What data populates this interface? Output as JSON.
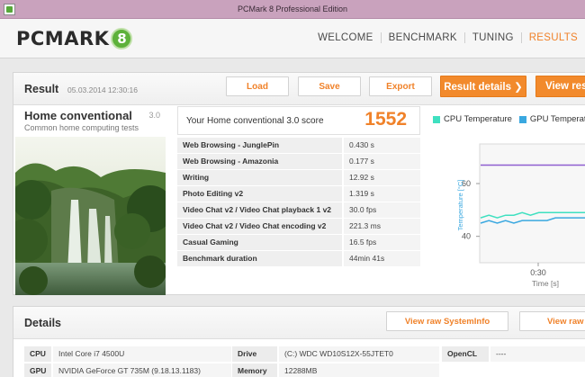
{
  "window": {
    "title": "PCMark 8 Professional Edition"
  },
  "logo": {
    "word": "PCMARK",
    "number": "8"
  },
  "nav": [
    {
      "label": "WELCOME",
      "active": false
    },
    {
      "label": "BENCHMARK",
      "active": false
    },
    {
      "label": "TUNING",
      "active": false
    },
    {
      "label": "RESULTS",
      "active": true
    }
  ],
  "result": {
    "title": "Result",
    "date": "05.03.2014 12:30:16",
    "buttons": {
      "load": "Load",
      "save": "Save",
      "export": "Export",
      "details": "Result details ❯",
      "view": "View resu"
    }
  },
  "test": {
    "name": "Home conventional",
    "version": "3.0",
    "description": "Common home computing tests"
  },
  "score": {
    "label": "Your Home conventional 3.0 score",
    "value": "1552",
    "rows": [
      {
        "name": "Web Browsing - JunglePin",
        "value": "0.430 s"
      },
      {
        "name": "Web Browsing - Amazonia",
        "value": "0.177 s"
      },
      {
        "name": "Writing",
        "value": "12.92 s"
      },
      {
        "name": "Photo Editing v2",
        "value": "1.319 s"
      },
      {
        "name": "Video Chat v2 / Video Chat playback 1 v2",
        "value": "30.0 fps"
      },
      {
        "name": "Video Chat v2 / Video Chat encoding v2",
        "value": "221.3 ms"
      },
      {
        "name": "Casual Gaming",
        "value": "16.5 fps"
      },
      {
        "name": "Benchmark duration",
        "value": "44min 41s"
      }
    ]
  },
  "chart": {
    "legend_cpu": "CPU Temperature",
    "legend_gpu": "GPU Temperatur",
    "y_label": "Temperature [°C]",
    "x_label": "Time [s]",
    "y_tick_60": "60",
    "y_tick_40": "40",
    "x_tick": "0:30",
    "colors": {
      "cpu": "#3fe0c0",
      "gpu": "#3aa8e0",
      "purple": "#8f5fd0"
    }
  },
  "chart_data": {
    "type": "line",
    "xlabel": "Time [s]",
    "ylabel": "Temperature [°C]",
    "ylim": [
      30,
      75
    ],
    "yticks": [
      40,
      60
    ],
    "xticks": [
      "0:30"
    ],
    "series": [
      {
        "name": "CPU Temperature",
        "color": "#3fe0c0",
        "values": [
          47,
          48,
          47,
          48,
          48,
          49,
          48,
          49,
          49,
          49,
          49,
          49,
          49,
          49
        ]
      },
      {
        "name": "GPU Temperatur",
        "color": "#3aa8e0",
        "values": [
          45,
          46,
          45,
          46,
          45,
          46,
          46,
          46,
          46,
          47,
          47,
          47,
          47,
          47
        ]
      },
      {
        "color": "#8f5fd0",
        "values": [
          67,
          67,
          67,
          67,
          67,
          67,
          67,
          67,
          67,
          67,
          67,
          67,
          67,
          67
        ]
      }
    ]
  },
  "details": {
    "title": "Details",
    "buttons": {
      "sysinfo": "View raw SystemInfo",
      "view": "View raw"
    },
    "specs": [
      {
        "key": "CPU",
        "value": "Intel Core i7 4500U"
      },
      {
        "key": "GPU",
        "value": "NVIDIA GeForce GT 735M (9.18.13.1183)"
      },
      {
        "key": "Drive",
        "value": "(C:) WDC WD10S12X-55JTET0"
      },
      {
        "key": "Memory",
        "value": "12288MB"
      },
      {
        "key": "OpenCL",
        "value": "----"
      }
    ]
  }
}
